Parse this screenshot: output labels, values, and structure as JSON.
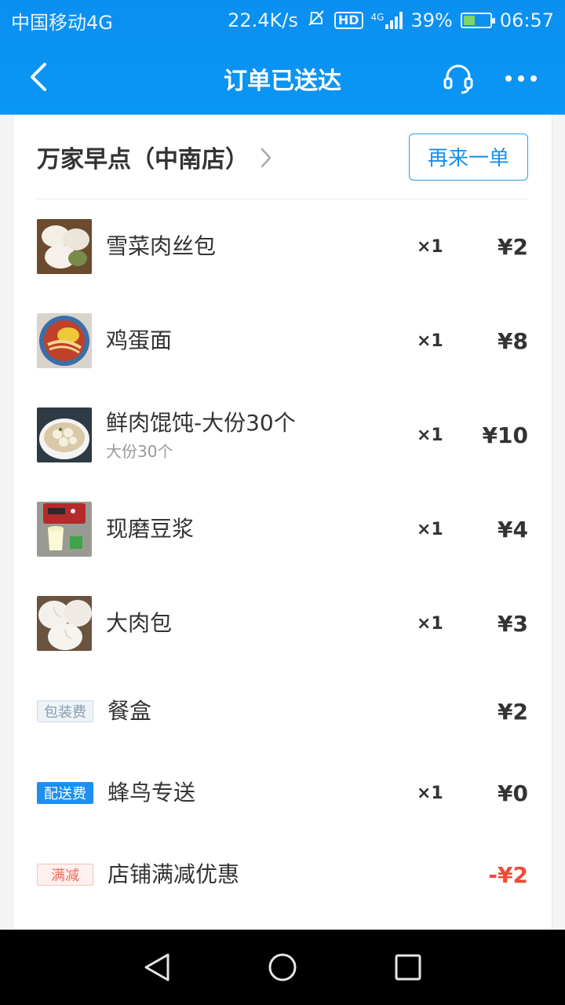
{
  "status_bar": {
    "carrier": "中国移动4G",
    "speed": "22.4K/s",
    "hd": "HD",
    "network": "4G",
    "battery": "39%",
    "time": "06:57"
  },
  "nav": {
    "title": "订单已送达",
    "back_icon": "chevron-left-icon",
    "service_icon": "headset-icon",
    "more_icon": "more-dots-icon"
  },
  "shop": {
    "name": "万家早点（中南店）",
    "reorder_label": "再来一单"
  },
  "items": [
    {
      "name": "雪菜肉丝包",
      "qty": "×1",
      "price": "¥2",
      "spec": ""
    },
    {
      "name": "鸡蛋面",
      "qty": "×1",
      "price": "¥8",
      "spec": ""
    },
    {
      "name": "鲜肉馄饨-大份30个",
      "qty": "×1",
      "price": "¥10",
      "spec": "大份30个"
    },
    {
      "name": "现磨豆浆",
      "qty": "×1",
      "price": "¥4",
      "spec": ""
    },
    {
      "name": "大肉包",
      "qty": "×1",
      "price": "¥3",
      "spec": ""
    }
  ],
  "fees": [
    {
      "tag": "包装费",
      "name": "餐盒",
      "qty": "",
      "price": "¥2"
    },
    {
      "tag": "配送费",
      "name": "蜂鸟专送",
      "qty": "×1",
      "price": "¥0"
    },
    {
      "tag": "满减",
      "name": "店铺满减优惠",
      "qty": "",
      "price": "-¥2"
    }
  ],
  "colors": {
    "header": "#0a8ff0",
    "accent": "#1b8fe8",
    "discount": "#f04a3a"
  }
}
